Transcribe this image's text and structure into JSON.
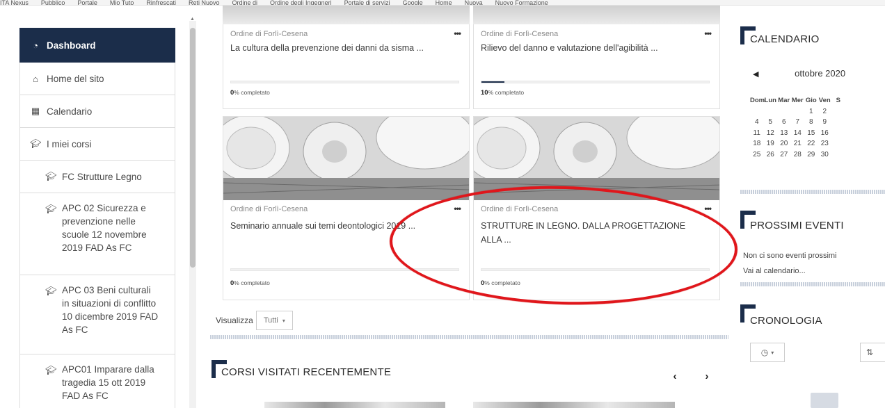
{
  "bookmarks": [
    "ITA Nexus",
    "Pubblico",
    "Portale",
    "Mio Tuto",
    "Rinfrescati",
    "Reti Nuovo",
    "Ordine di",
    "Ordine degli Ingegneri",
    "Portale di servizi",
    "Google",
    "Home",
    "Nuova",
    "Nuovo Formazione"
  ],
  "sidebar": {
    "items": [
      {
        "label": "Dashboard",
        "icon": "tachometer-icon"
      },
      {
        "label": "Home del sito",
        "icon": "home-icon"
      },
      {
        "label": "Calendario",
        "icon": "calendar-icon"
      },
      {
        "label": "I miei corsi",
        "icon": "graduation-cap-icon"
      },
      {
        "label": "FC Strutture Legno",
        "icon": "graduation-cap-icon"
      },
      {
        "label": "APC 02 Sicurezza e prevenzione nelle scuole 12 novembre 2019 FAD As FC",
        "icon": "graduation-cap-icon"
      },
      {
        "label": "APC 03 Beni culturali in situazioni di conflitto 10 dicembre 2019 FAD As FC",
        "icon": "graduation-cap-icon"
      },
      {
        "label": "APC01 Imparare dalla tragedia 15 ott 2019 FAD As FC",
        "icon": "graduation-cap-icon"
      }
    ]
  },
  "courses": [
    {
      "category": "Ordine di Forlì-Cesena",
      "title": "La cultura della prevenzione dei danni da sisma ...",
      "progress_pct": 0,
      "progress_label": "% completato",
      "progress_num": "0"
    },
    {
      "category": "Ordine di Forlì-Cesena",
      "title": "Rilievo del danno e valutazione dell'agibilità ...",
      "progress_pct": 10,
      "progress_label": "% completato",
      "progress_num": "10"
    },
    {
      "category": "Ordine di Forlì-Cesena",
      "title": "Seminario annuale sui temi deontologici 2019 ...",
      "progress_pct": 0,
      "progress_label": "% completato",
      "progress_num": "0"
    },
    {
      "category": "Ordine di Forlì-Cesena",
      "title": "STRUTTURE IN LEGNO. DALLA PROGETTAZIONE ALLA ...",
      "progress_pct": 0,
      "progress_label": "% completato",
      "progress_num": "0"
    }
  ],
  "view": {
    "label": "Visualizza",
    "selected": "Tutti"
  },
  "recent": {
    "title": "CORSI VISITATI RECENTEMENTE"
  },
  "calendar": {
    "title": "CALENDARIO",
    "month": "ottobre 2020",
    "days": [
      "Dom",
      "Lun",
      "Mar",
      "Mer",
      "Gio",
      "Ven",
      "S"
    ],
    "weeks": [
      [
        "",
        "",
        "",
        "",
        "1",
        "2",
        ""
      ],
      [
        "4",
        "5",
        "6",
        "7",
        "8",
        "9",
        ""
      ],
      [
        "11",
        "12",
        "13",
        "14",
        "15",
        "16",
        ""
      ],
      [
        "18",
        "19",
        "20",
        "21",
        "22",
        "23",
        ""
      ],
      [
        "25",
        "26",
        "27",
        "28",
        "29",
        "30",
        ""
      ]
    ]
  },
  "events": {
    "title": "PROSSIMI EVENTI",
    "empty": "Non ci sono eventi prossimi",
    "link": "Vai al calendario..."
  },
  "timeline": {
    "title": "CRONOLOGIA"
  },
  "colors": {
    "nav_active": "#1b2d4a",
    "annotation": "#e0161b"
  }
}
